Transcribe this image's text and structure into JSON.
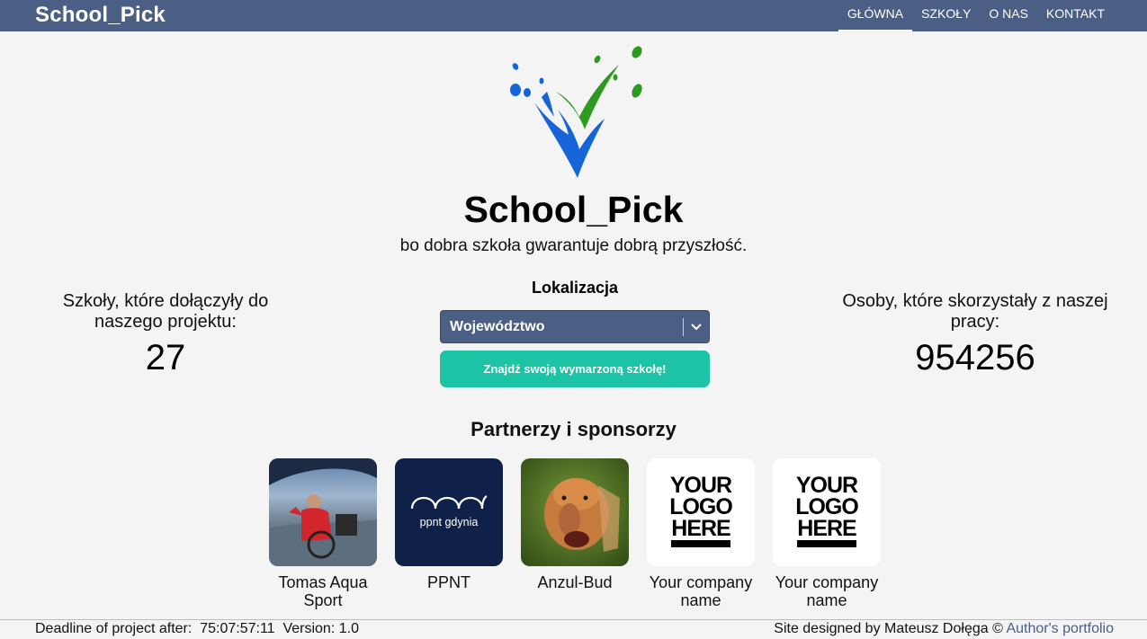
{
  "header": {
    "brand": "School_Pick",
    "nav": [
      {
        "label": "GŁÓWNA",
        "active": true
      },
      {
        "label": "SZKOŁY",
        "active": false
      },
      {
        "label": "O NAS",
        "active": false
      },
      {
        "label": "KONTAKT",
        "active": false
      }
    ]
  },
  "hero": {
    "title": "School_Pick",
    "tagline": "bo dobra szkoła gwarantuje dobrą przyszłość.",
    "logo_icon": "checkmark-splash-logo"
  },
  "stats": {
    "schools_label": "Szkoły, które dołączyły do naszego projektu:",
    "schools_value": "27",
    "users_label": "Osoby, które skorzystały z naszej pracy:",
    "users_value": "954256"
  },
  "search": {
    "location_label": "Lokalizacja",
    "select_value": "Województwo",
    "button_label": "Znajdź swoją wymarzoną szkołę!"
  },
  "partners": {
    "title": "Partnerzy i sponsorzy",
    "items": [
      {
        "name": "Tomas Aqua Sport"
      },
      {
        "name": "PPNT",
        "logo_text": "ppnt gdynia"
      },
      {
        "name": "Anzul-Bud"
      },
      {
        "name": "Your company name",
        "logo_text": "YOUR LOGO HERE"
      },
      {
        "name": "Your company name",
        "logo_text": "YOUR LOGO HERE"
      }
    ]
  },
  "footer": {
    "deadline_label": "Deadline of project after:",
    "deadline_value": "75:07:57:11",
    "version_label": "Version:",
    "version_value": "1.0",
    "credit": "Site designed by Mateusz Dołęga ©",
    "portfolio_link": "Author's portfolio"
  },
  "colors": {
    "header_bg": "#4b5e84",
    "button_bg": "#1cc3a5",
    "page_bg": "#f4f4f4",
    "logo_blue": "#1565d8",
    "logo_green": "#2d9b1f"
  }
}
